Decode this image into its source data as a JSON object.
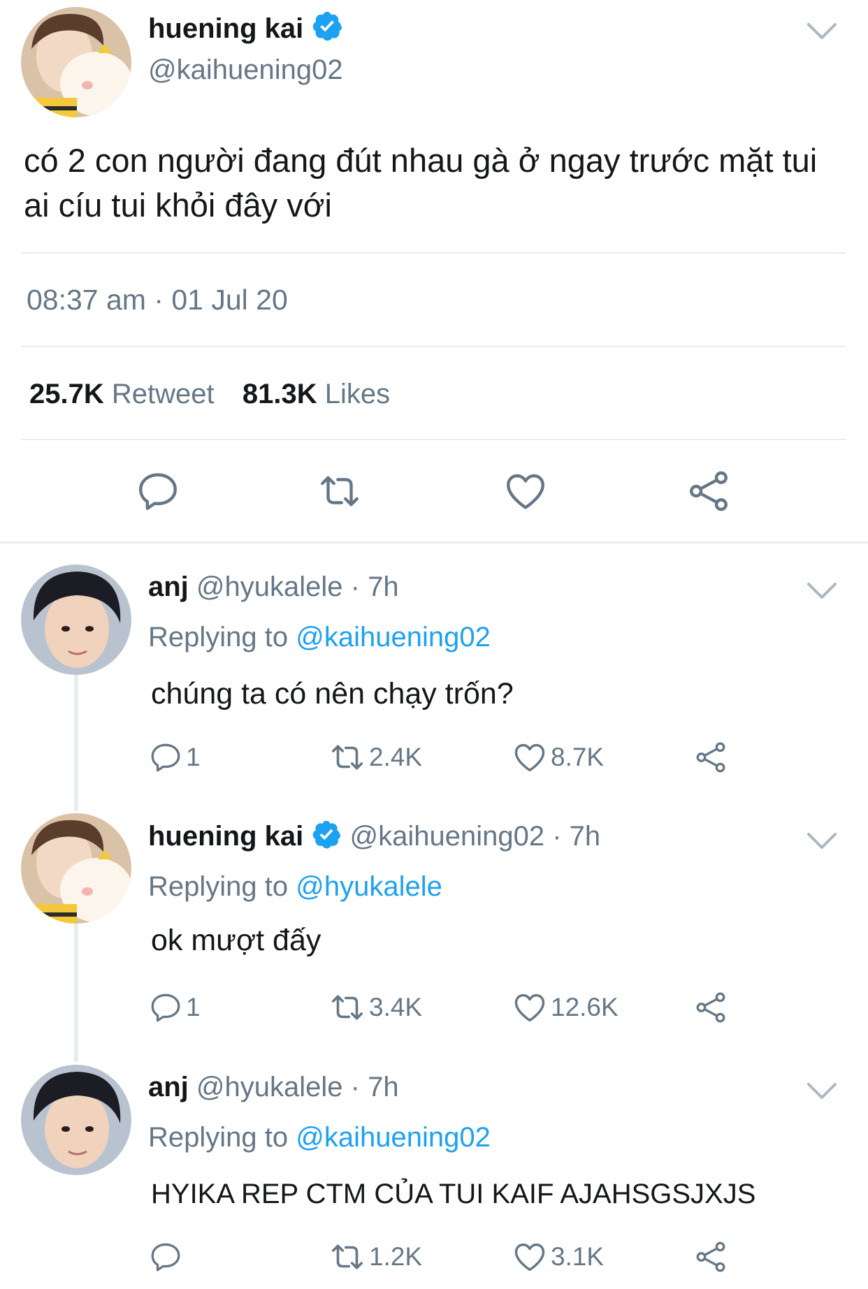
{
  "main_tweet": {
    "name": "huening kai",
    "handle": "@kaihuening02",
    "text_line1": "có 2 con người đang đút nhau gà ở ngay trước mặt tui",
    "text_line2": "ai cíu tui khỏi đây với",
    "timestamp": "08:37 am · 01 Jul 20",
    "retweet_count": "25.7K",
    "retweet_label": "Retweet",
    "likes_count": "81.3K",
    "likes_label": "Likes"
  },
  "replies": [
    {
      "name": "anj",
      "handle_time": "@hyukalele · 7h",
      "replying_label": "Replying to",
      "replying_to": "@kaihuening02",
      "text": "chúng ta có nên chạy trốn?",
      "replies": "1",
      "retweets": "2.4K",
      "likes": "8.7K"
    },
    {
      "name": "huening kai",
      "handle_time": "@kaihuening02 · 7h",
      "replying_label": "Replying to",
      "replying_to": "@hyukalele",
      "text": "ok mượt đấy",
      "replies": "1",
      "retweets": "3.4K",
      "likes": "12.6K"
    },
    {
      "name": "anj",
      "handle_time": "@hyukalele · 7h",
      "replying_label": "Replying to",
      "replying_to": "@kaihuening02",
      "text": "HYIKA REP CTM CỦA TUI KAIF AJAHSGSJXJS",
      "replies": "",
      "retweets": "1.2K",
      "likes": "3.1K"
    }
  ],
  "colors": {
    "accent": "#1da1f2",
    "secondary_text": "#657786",
    "divider": "#e6ecf0"
  },
  "icons": [
    "reply-icon",
    "retweet-icon",
    "like-icon",
    "share-icon",
    "chevron-down-icon",
    "verified-icon"
  ]
}
